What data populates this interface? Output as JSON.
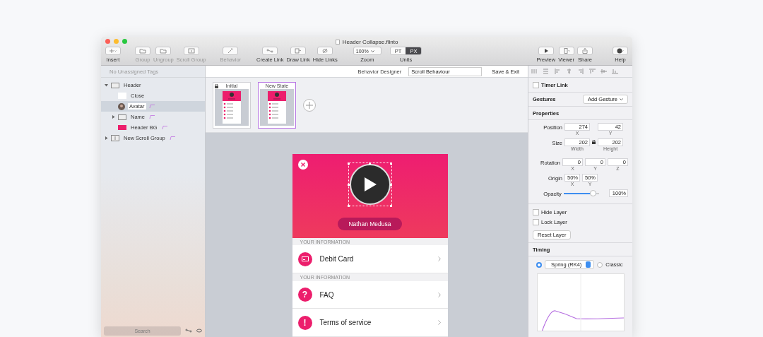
{
  "window": {
    "title": "Header Collapse.flinto"
  },
  "toolbar": {
    "left": [
      {
        "kind": "insert",
        "label": "Insert",
        "disabled": false
      },
      {
        "kind": "folder",
        "label": "Group",
        "disabled": true
      },
      {
        "kind": "folder",
        "label": "Ungroup",
        "disabled": true
      },
      {
        "kind": "scroll",
        "label": "Scroll Group",
        "disabled": true
      },
      {
        "kind": "wand",
        "label": "Behavior",
        "disabled": true
      },
      {
        "kind": "link",
        "label": "Create Link",
        "disabled": false
      },
      {
        "kind": "draw",
        "label": "Draw Link",
        "disabled": false
      },
      {
        "kind": "hide",
        "label": "Hide Links",
        "disabled": false
      }
    ],
    "zoom": {
      "value": "100%",
      "label": "Zoom"
    },
    "units": {
      "label": "Units",
      "options": [
        {
          "label": "PT",
          "selected": false
        },
        {
          "label": "PX",
          "selected": true
        }
      ]
    },
    "right": [
      {
        "kind": "play",
        "label": "Preview",
        "disabled": false
      },
      {
        "kind": "viewer",
        "label": "Viewer",
        "disabled": false
      },
      {
        "kind": "share",
        "label": "Share",
        "disabled": false
      },
      {
        "kind": "help",
        "label": "Help",
        "disabled": false
      }
    ]
  },
  "sidebar": {
    "header": "No Unassigned Tags",
    "search_placeholder": "Search",
    "layers": [
      {
        "label": "Header",
        "kind": "folder",
        "expanded": true,
        "selected": false,
        "linked": false,
        "children": [
          {
            "label": "Close",
            "kind": "blank",
            "selected": false,
            "linked": false
          },
          {
            "label": "Avatar",
            "kind": "avatar",
            "selected": true,
            "linked": true
          },
          {
            "label": "Name",
            "kind": "folder",
            "expanded": false,
            "selected": false,
            "linked": true
          },
          {
            "label": "Header BG",
            "kind": "rect",
            "selected": false,
            "linked": true
          }
        ]
      },
      {
        "label": "New Scroll Group",
        "kind": "scroll",
        "expanded": false,
        "selected": false,
        "linked": true
      }
    ]
  },
  "behavior_bar": {
    "title": "Behavior Designer",
    "name_value": "Scroll Behaviour",
    "save_button": "Save & Exit"
  },
  "states": [
    {
      "label": "Initial",
      "locked": true,
      "selected": false
    },
    {
      "label": "New State",
      "locked": false,
      "selected": true
    }
  ],
  "phone": {
    "name": "Nathan Medusa",
    "sections": [
      {
        "kind": "header",
        "text": "YOUR INFORMATION"
      },
      {
        "kind": "card",
        "label": "Debit Card"
      },
      {
        "kind": "header",
        "text": "YOUR INFORMATION"
      },
      {
        "kind": "glyph",
        "glyph": "?",
        "label": "FAQ"
      },
      {
        "kind": "glyph",
        "glyph": "!",
        "label": "Terms of service"
      }
    ]
  },
  "inspector": {
    "timer_link": {
      "label": "Timer Link",
      "checked": false
    },
    "gestures": {
      "title": "Gestures",
      "button": "Add Gesture"
    },
    "properties": {
      "title": "Properties",
      "rows": [
        {
          "label": "Position",
          "fields": [
            {
              "value": "274",
              "caption": "X"
            },
            {
              "value": "42",
              "caption": "Y"
            }
          ]
        },
        {
          "label": "Size",
          "fields": [
            {
              "value": "202",
              "caption": "Width"
            },
            {
              "value": "202",
              "caption": "Height"
            }
          ],
          "locked": true
        },
        {
          "label": "Rotation",
          "fields": [
            {
              "value": "0",
              "caption": "X"
            },
            {
              "value": "0",
              "caption": "Y"
            },
            {
              "value": "0",
              "caption": "Z"
            }
          ]
        },
        {
          "label": "Origin",
          "fields": [
            {
              "value": "50%",
              "caption": "X"
            },
            {
              "value": "50%",
              "caption": "Y"
            }
          ]
        }
      ],
      "opacity": {
        "label": "Opacity",
        "level": 0.92,
        "reading": "100%"
      }
    },
    "options": [
      {
        "label": "Hide Layer",
        "checked": false
      },
      {
        "label": "Lock Layer",
        "checked": false
      }
    ],
    "reset_button": "Reset Layer",
    "timing": {
      "title": "Timing",
      "modes": [
        {
          "label": "Spring (RK4)",
          "selected": true
        },
        {
          "label": "Classic",
          "selected": false
        }
      ]
    }
  }
}
